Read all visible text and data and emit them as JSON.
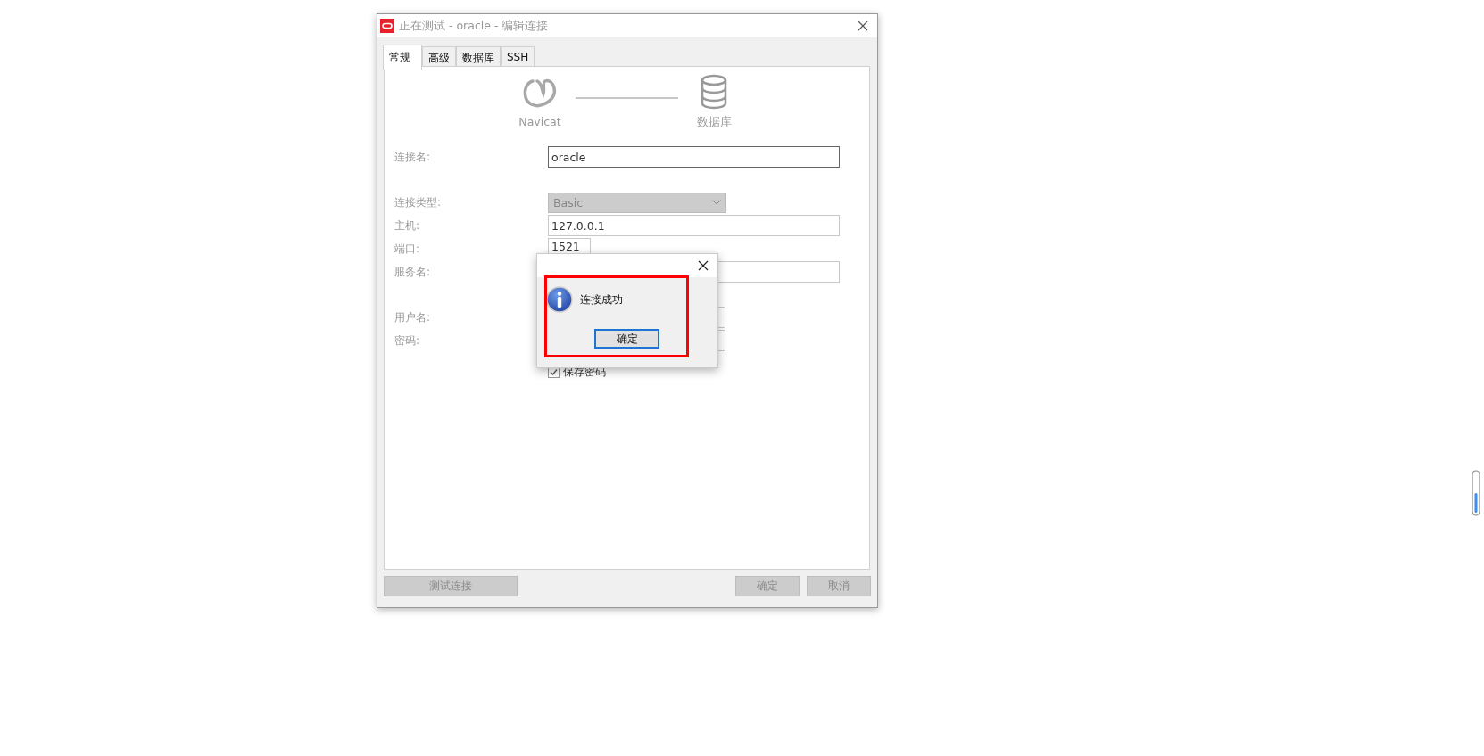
{
  "window": {
    "title": "正在测试 - oracle - 编辑连接"
  },
  "tabs": [
    {
      "label": "常规",
      "selected": true
    },
    {
      "label": "高级",
      "selected": false
    },
    {
      "label": "数据库",
      "selected": false
    },
    {
      "label": "SSH",
      "selected": false
    }
  ],
  "diagram": {
    "left_label": "Navicat",
    "right_label": "数据库"
  },
  "form_groups": [
    [
      {
        "kind": "text",
        "label": "连接名:",
        "value": "oracle"
      }
    ],
    [
      {
        "kind": "select",
        "label": "连接类型:",
        "value": "Basic"
      },
      {
        "kind": "text",
        "label": "主机:",
        "value": "127.0.0.1"
      },
      {
        "kind": "port",
        "label": "端口:",
        "value": "1521"
      },
      {
        "kind": "text",
        "label": "服务名:"
      }
    ],
    [
      {
        "kind": "medium",
        "label": "用户名:"
      },
      {
        "kind": "medium",
        "label": "密码:"
      },
      {
        "kind": "checkbox",
        "label": "保存密码",
        "checked": true
      }
    ]
  ],
  "footer": {
    "left_buttons": [
      {
        "label": "测试连接",
        "disabled": true
      }
    ],
    "right_buttons": [
      {
        "label": "确定",
        "disabled": true
      },
      {
        "label": "取消",
        "disabled": true
      }
    ]
  },
  "dialog": {
    "message": "连接成功",
    "button": "确定",
    "highlighted": true
  }
}
